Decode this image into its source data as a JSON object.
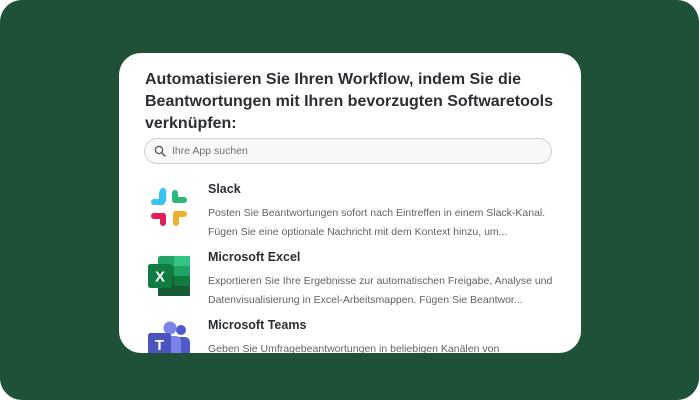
{
  "heading": "Automatisieren Sie Ihren Workflow, indem Sie die Beantwortungen mit Ihren bevorzugten Softwaretools verknüpfen:",
  "search": {
    "placeholder": "Ihre App suchen",
    "icon": "search-icon"
  },
  "apps": [
    {
      "name": "Slack",
      "icon": "slack-icon",
      "description": "Posten Sie Beantwortungen sofort nach Eintreffen in einem Slack-Kanal. Fügen Sie eine optionale Nachricht mit dem Kontext hinzu, um..."
    },
    {
      "name": "Microsoft Excel",
      "icon": "excel-icon",
      "description": "Exportieren Sie Ihre Ergebnisse zur automatischen Freigabe, Analyse und Datenvisualisierung in Excel-Arbeitsmappen. Fügen Sie Beantwor..."
    },
    {
      "name": "Microsoft Teams",
      "icon": "teams-icon",
      "description": "Geben Sie Umfragebeantwortungen in beliebigen Kanälen von"
    }
  ],
  "colors": {
    "background": "#1e5138",
    "card": "#ffffff",
    "heading_text": "#2b2f33",
    "body_text": "#5f6366"
  }
}
